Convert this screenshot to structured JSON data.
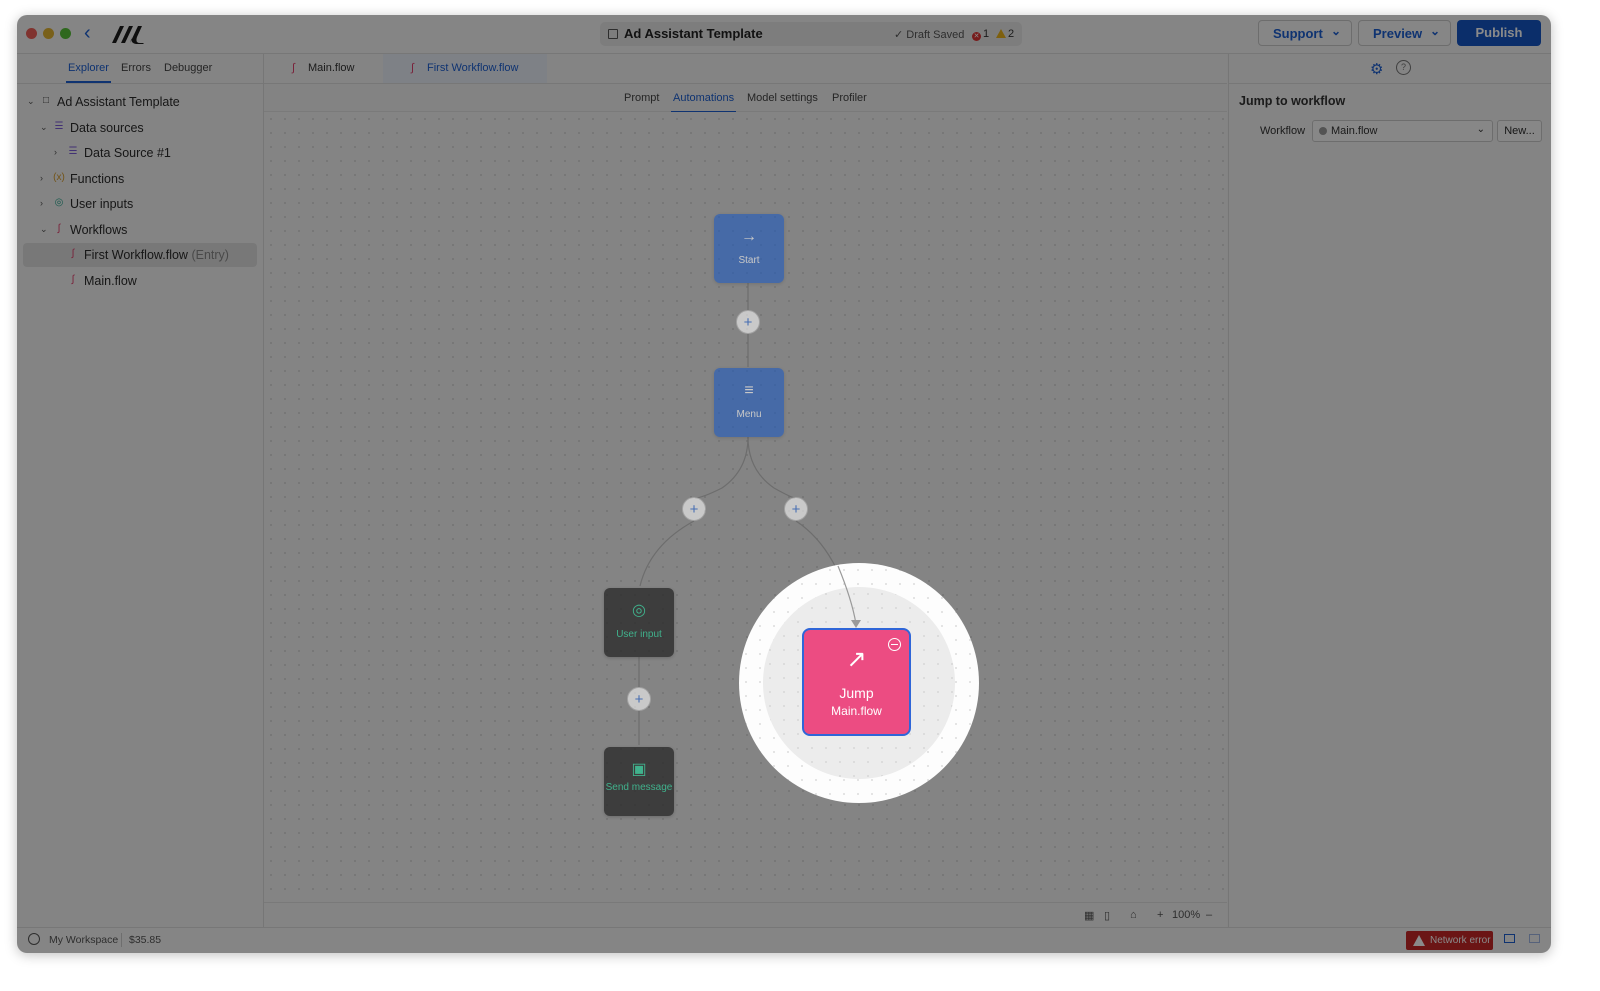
{
  "app": {
    "document_title": "Ad Assistant Template",
    "draft_status": "Draft Saved",
    "error_count": "1",
    "warning_count": "2"
  },
  "toolbar": {
    "support_label": "Support",
    "preview_label": "Preview",
    "publish_label": "Publish"
  },
  "left_tabs": [
    "Explorer",
    "Errors",
    "Debugger"
  ],
  "tree": {
    "root": "Ad Assistant Template",
    "data_sources": "Data sources",
    "data_source_1": "Data Source #1",
    "functions": "Functions",
    "user_inputs": "User inputs",
    "workflows": "Workflows",
    "first_workflow": "First Workflow.flow",
    "entry_tag": "(Entry)",
    "main_flow": "Main.flow"
  },
  "file_tabs": [
    "Main.flow",
    "First Workflow.flow"
  ],
  "sub_tabs": [
    "Prompt",
    "Automations",
    "Model settings",
    "Profiler"
  ],
  "nodes": {
    "start": "Start",
    "menu": "Menu",
    "user_input": "User input",
    "send_message": "Send message",
    "jump_title": "Jump",
    "jump_target": "Main.flow"
  },
  "canvas_controls": {
    "zoom": "100%"
  },
  "right_panel": {
    "heading": "Jump to workflow",
    "workflow_label": "Workflow",
    "workflow_value": "Main.flow",
    "new_button": "New..."
  },
  "status_bar": {
    "workspace": "My Workspace",
    "cost": "$35.85",
    "network_error": "Network error"
  },
  "colors": {
    "accent": "#1c5fd1",
    "publish": "#1556c4",
    "jump_node": "#ec4c82",
    "error": "#c62828"
  }
}
